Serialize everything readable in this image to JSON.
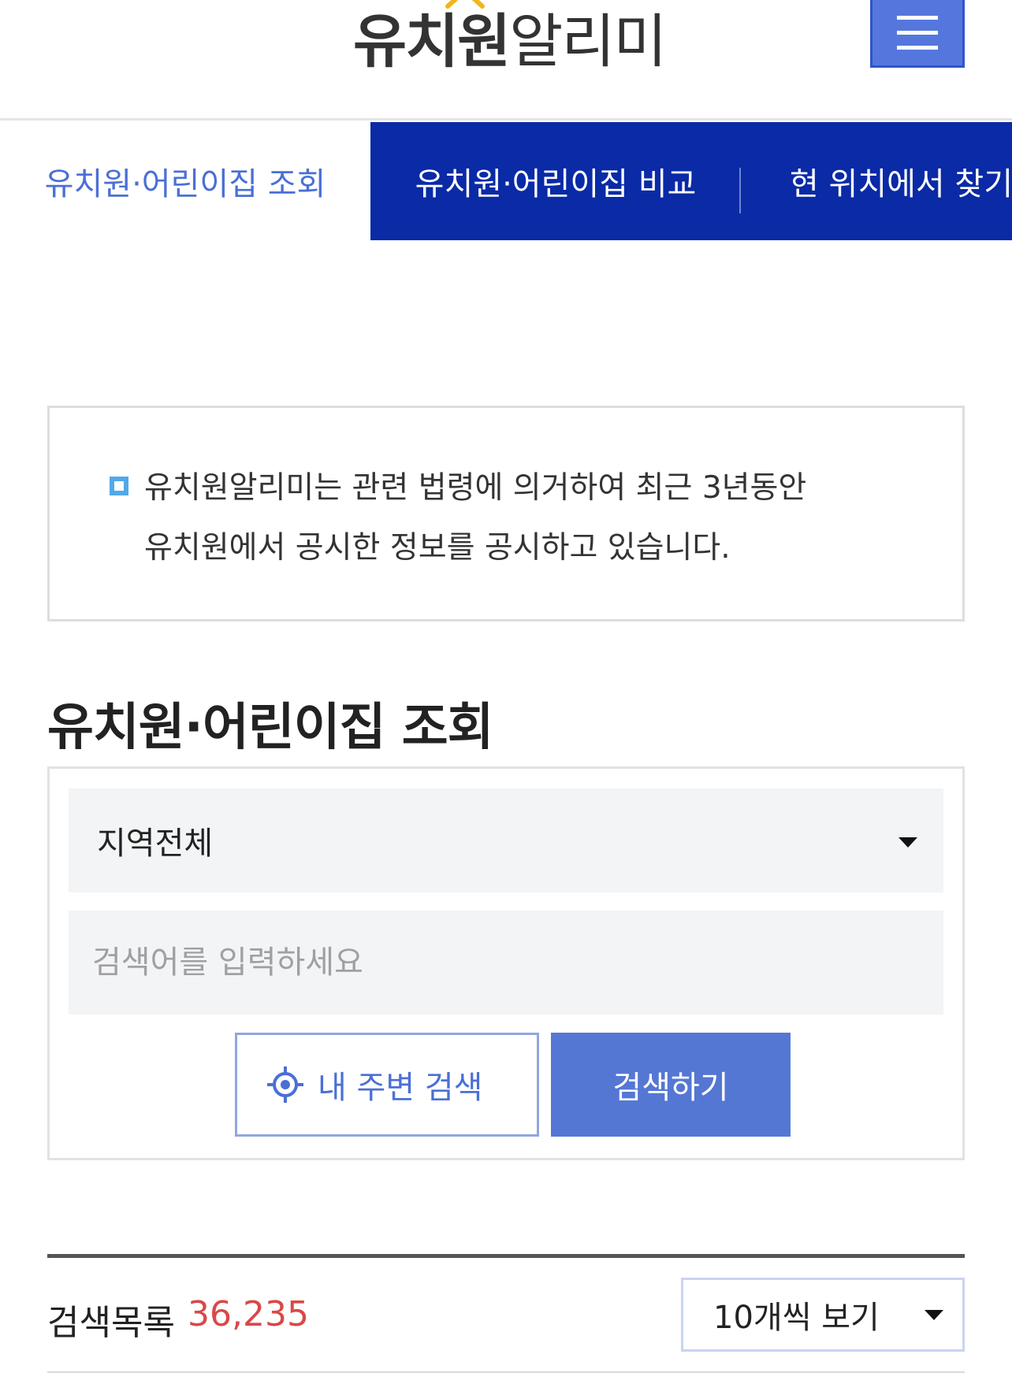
{
  "header": {
    "logo_bold": "유치원",
    "logo_light": "알리미",
    "logo_mark_color": "#f2b51d",
    "menu_icon": "hamburger-menu-icon"
  },
  "tabs": [
    {
      "label": "유치원·어린이집 조회",
      "active": true
    },
    {
      "label": "유치원·어린이집 비교",
      "active": false
    },
    {
      "label": "현 위치에서 찾기",
      "active": false
    }
  ],
  "notice": {
    "line1": "유치원알리미는 관련 법령에 의거하여 최근 3년동안",
    "line2": "유치원에서 공시한 정보를 공시하고 있습니다."
  },
  "section_title": "유치원·어린이집 조회",
  "search": {
    "region_selected": "지역전체",
    "keyword_placeholder": "검색어를 입력하세요",
    "keyword_value": "",
    "nearby_label": "내 주변 검색",
    "nearby_icon": "location-target-icon",
    "submit_label": "검색하기"
  },
  "results": {
    "label": "검색목록",
    "count": "36,235",
    "per_page": "10개씩 보기"
  },
  "colors": {
    "primary_blue": "#0a2aa6",
    "accent_blue": "#5577d4",
    "active_tab_text": "#4a6fd6",
    "count_red": "#d94848"
  }
}
